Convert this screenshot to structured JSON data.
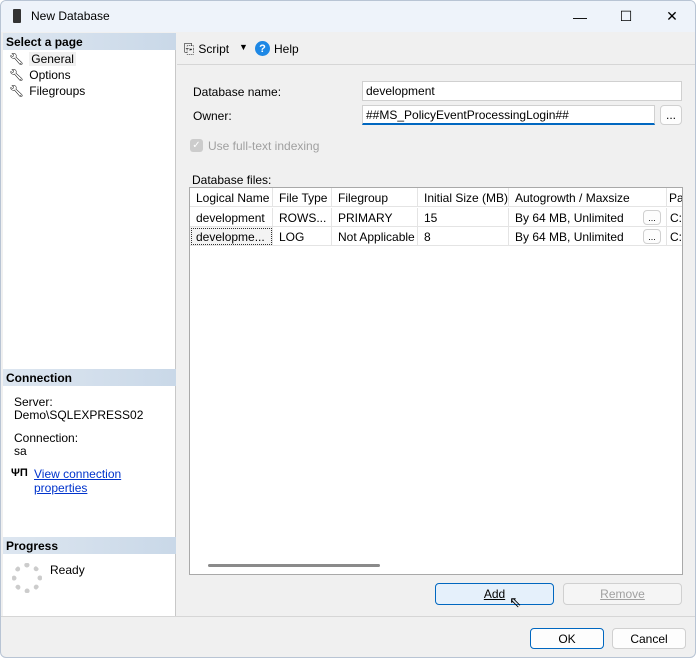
{
  "window": {
    "title": "New Database",
    "minimize": "—",
    "maximize": "☐",
    "close": "✕"
  },
  "left": {
    "select_page": "Select a page",
    "pages": [
      {
        "label": "General"
      },
      {
        "label": "Options"
      },
      {
        "label": "Filegroups"
      }
    ],
    "connection_header": "Connection",
    "server_label": "Server:",
    "server_value": "Demo\\SQLEXPRESS02",
    "connection_label": "Connection:",
    "connection_value": "sa",
    "view_props": "View connection properties",
    "progress_header": "Progress",
    "progress_status": "Ready"
  },
  "toolbar": {
    "script": "Script",
    "help": "Help"
  },
  "form": {
    "dbname_label": "Database name:",
    "dbname_value": "development",
    "owner_label": "Owner:",
    "owner_value": "##MS_PolicyEventProcessingLogin##",
    "browse": "...",
    "fulltext_label": "Use full-text indexing",
    "fulltext_checked": true,
    "files_label": "Database files:"
  },
  "grid": {
    "columns": [
      "Logical Name",
      "File Type",
      "Filegroup",
      "Initial Size (MB)",
      "Autogrowth / Maxsize",
      "Pa"
    ],
    "rows": [
      {
        "name": "development",
        "type": "ROWS...",
        "filegroup": "PRIMARY",
        "size": "15",
        "autogrowth": "By 64 MB, Unlimited",
        "btn": "...",
        "path": "C:"
      },
      {
        "name": "developme...",
        "type": "LOG",
        "filegroup": "Not Applicable",
        "size": "8",
        "autogrowth": "By 64 MB, Unlimited",
        "btn": "...",
        "path": "C:"
      }
    ]
  },
  "buttons": {
    "add": "Add",
    "remove": "Remove",
    "ok": "OK",
    "cancel": "Cancel"
  }
}
